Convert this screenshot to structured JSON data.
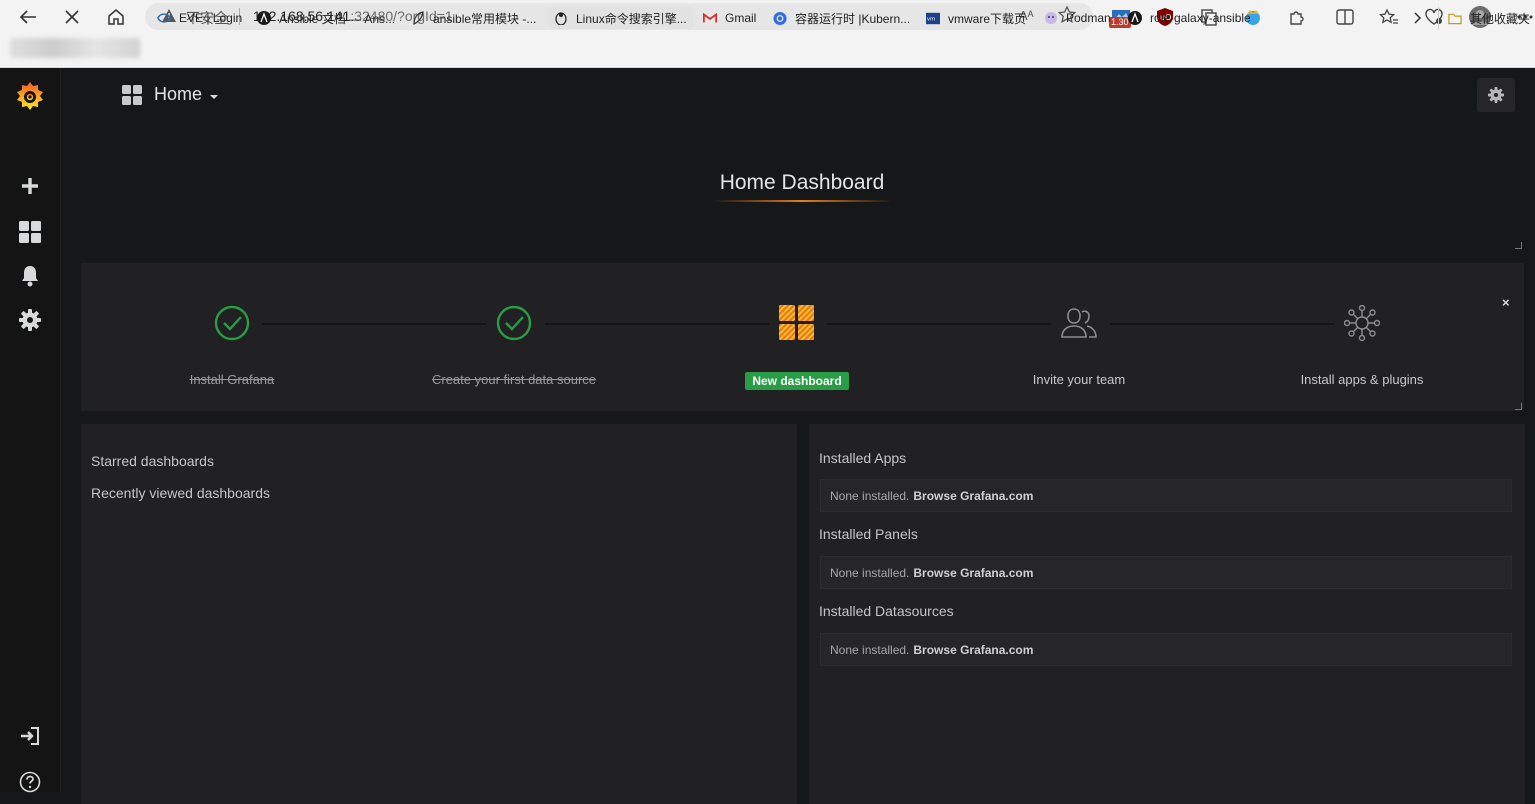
{
  "browser": {
    "security_label": "不安全",
    "url_host": "192.168.56.141",
    "url_rest": ":32480/?orgId=1",
    "read_aloud": "Aᴬ",
    "extension_badge": "1.30"
  },
  "bookmarks": [
    {
      "label": "EVE | Login"
    },
    {
      "label": "Ansible 文档 — Ans..."
    },
    {
      "label": "ansible常用模块 -..."
    },
    {
      "label": "Linux命令搜索引擎..."
    },
    {
      "label": "Gmail"
    },
    {
      "label": "容器运行时 |Kubern..."
    },
    {
      "label": "vmware下载页"
    },
    {
      "label": "Podman"
    },
    {
      "label": "role-galaxy-ansible"
    }
  ],
  "bookmarks_overflow": "其他收藏夹",
  "nav": {
    "title": "Home"
  },
  "dashboard": {
    "title": "Home Dashboard"
  },
  "getting_started": {
    "steps": [
      {
        "label": "Install Grafana",
        "state": "done"
      },
      {
        "label": "Create your first data source",
        "state": "done"
      },
      {
        "label": "New dashboard",
        "state": "current"
      },
      {
        "label": "Invite your team",
        "state": "todo"
      },
      {
        "label": "Install apps & plugins",
        "state": "todo"
      }
    ],
    "close_label": "×"
  },
  "dashboards_panel": {
    "starred": "Starred dashboards",
    "recent": "Recently viewed dashboards"
  },
  "plugins_panel": {
    "sections": [
      {
        "heading": "Installed Apps",
        "text": "None installed.",
        "link": "Browse Grafana.com"
      },
      {
        "heading": "Installed Panels",
        "text": "None installed.",
        "link": "Browse Grafana.com"
      },
      {
        "heading": "Installed Datasources",
        "text": "None installed.",
        "link": "Browse Grafana.com"
      }
    ]
  },
  "colors": {
    "accent": "#eb7b18",
    "success": "#299c46",
    "panel_bg": "#212124",
    "page_bg": "#161719"
  }
}
